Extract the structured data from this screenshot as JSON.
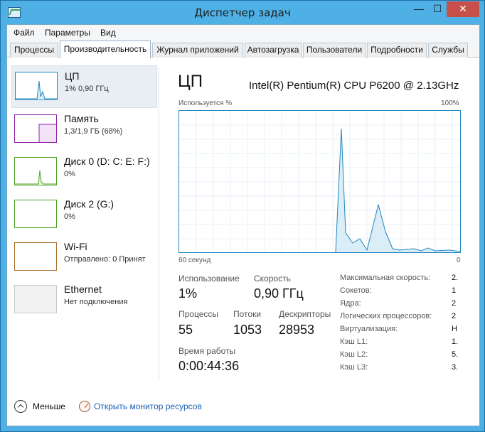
{
  "window": {
    "title": "Диспетчер задач",
    "controls": {
      "minimize": "—",
      "maximize": "☐",
      "close": "✕"
    }
  },
  "menu": [
    "Файл",
    "Параметры",
    "Вид"
  ],
  "tabs": [
    {
      "label": "Процессы"
    },
    {
      "label": "Производительность",
      "active": true
    },
    {
      "label": "Журнал приложений"
    },
    {
      "label": "Автозагрузка"
    },
    {
      "label": "Пользователи"
    },
    {
      "label": "Подробности"
    },
    {
      "label": "Службы"
    }
  ],
  "sidebar": {
    "items": [
      {
        "name": "ЦП",
        "detail": "1% 0,90 ГГц",
        "color": "#1f86c0",
        "selected": true
      },
      {
        "name": "Память",
        "detail": "1,3/1,9 ГБ (68%)",
        "color": "#8b21a8"
      },
      {
        "name": "Диск 0 (D: C: E: F:)",
        "detail": "0%",
        "color": "#4da123"
      },
      {
        "name": "Диск 2 (G:)",
        "detail": "0%",
        "color": "#4da123"
      },
      {
        "name": "Wi-Fi",
        "detail_prefix": "Отправлено: ",
        "detail_value": "0",
        "detail_suffix": " Принят",
        "color": "#a7692a"
      },
      {
        "name": "Ethernet",
        "detail": "Нет подключения",
        "color": "#c8c8c8"
      }
    ]
  },
  "main": {
    "title": "ЦП",
    "cpu_name": "Intel(R) Pentium(R) CPU P6200 @ 2.13GHz",
    "graph": {
      "top_left": "Используется %",
      "top_right": "100%",
      "bottom_left": "60 секунд",
      "bottom_right": "0",
      "accent": "#1f86c0"
    },
    "stats": {
      "usage_label": "Использование",
      "usage_value": "1%",
      "speed_label": "Скорость",
      "speed_value": "0,90 ГГц",
      "processes_label": "Процессы",
      "processes_value": "55",
      "threads_label": "Потоки",
      "threads_value": "1053",
      "handles_label": "Дескрипторы",
      "handles_value": "28953",
      "uptime_label": "Время работы",
      "uptime_value": "0:00:44:36"
    },
    "info": [
      {
        "label": "Максимальная скорость:",
        "value": "2."
      },
      {
        "label": "Сокетов:",
        "value": "1"
      },
      {
        "label": "Ядра:",
        "value": "2"
      },
      {
        "label": "Логических процессоров:",
        "value": "2"
      },
      {
        "label": "Виртуализация:",
        "value": "Н"
      },
      {
        "label": "Кэш L1:",
        "value": "1."
      },
      {
        "label": "Кэш L2:",
        "value": "5."
      },
      {
        "label": "Кэш L3:",
        "value": "3."
      }
    ]
  },
  "footer": {
    "fewer_label": "Меньше",
    "monitor_link": "Открыть монитор ресурсов"
  }
}
